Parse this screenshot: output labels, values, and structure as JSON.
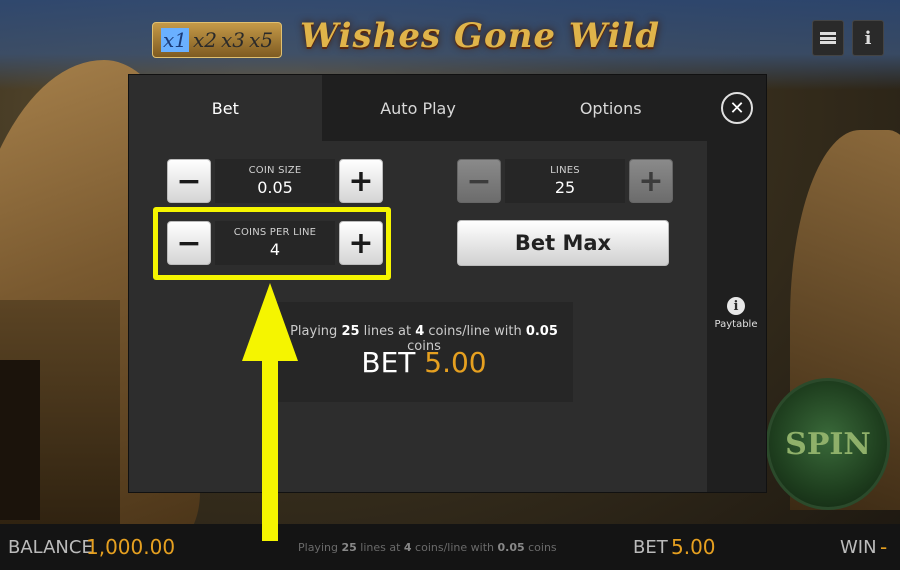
{
  "game": {
    "multipliers": [
      "x1",
      "x2",
      "x3",
      "x5"
    ],
    "logo_text": "Wishes Gone Wild"
  },
  "tabs": [
    {
      "label": "Bet",
      "active": true
    },
    {
      "label": "Auto Play",
      "active": false
    },
    {
      "label": "Options",
      "active": false
    }
  ],
  "bet_panel": {
    "coin_size": {
      "label": "COIN SIZE",
      "value": "0.05",
      "minus": "−",
      "plus": "+"
    },
    "coins_per_line": {
      "label": "COINS PER LINE",
      "value": "4",
      "minus": "−",
      "plus": "+"
    },
    "lines": {
      "label": "LINES",
      "value": "25",
      "minus": "−",
      "plus": "+"
    },
    "bet_max_label": "Bet Max",
    "summary": {
      "prefix": "Playing ",
      "lines": "25",
      "mid1": " lines at ",
      "coins": "4",
      "mid2": " coins/line with ",
      "coin_size": "0.05",
      "suffix": " coins",
      "bet_label": "BET ",
      "bet_value": "5.00"
    },
    "paytable_label": "Paytable"
  },
  "spin_label": "SPIN",
  "status_bar": {
    "balance_label": "BALANCE",
    "balance_value": "1,000.00",
    "playing_prefix": "Playing ",
    "playing_lines": "25",
    "playing_mid1": " lines at ",
    "playing_coins": "4",
    "playing_mid2": " coins/line with ",
    "playing_coin_size": "0.05",
    "playing_suffix": " coins",
    "bet_label": "BET",
    "bet_value": "5.00",
    "win_label": "WIN",
    "win_value": "-"
  },
  "colors": {
    "accent": "#e6a020",
    "highlight": "#f5f500"
  }
}
